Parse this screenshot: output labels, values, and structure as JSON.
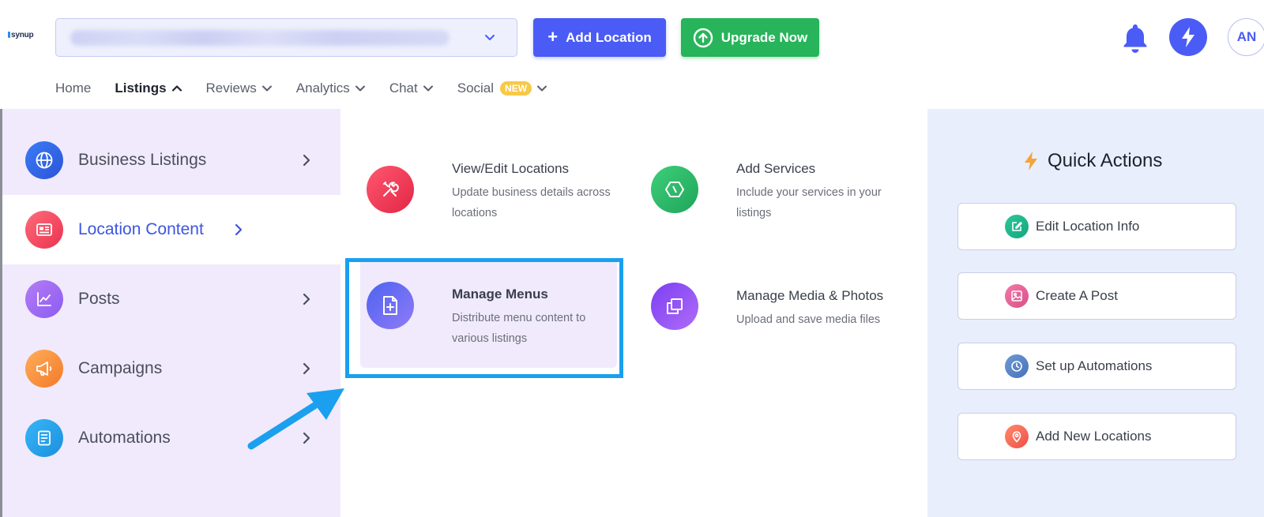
{
  "app": {
    "logo_text": "synup"
  },
  "header": {
    "location_select": {
      "value": ""
    },
    "add_location_label": "Add Location",
    "upgrade_label": "Upgrade Now",
    "avatar_initials": "AN",
    "colors": {
      "primary": "#4a5cf5",
      "success": "#27b45a"
    }
  },
  "nav": {
    "home": "Home",
    "listings": "Listings",
    "reviews": "Reviews",
    "analytics": "Analytics",
    "chat": "Chat",
    "social": "Social",
    "social_badge": "NEW"
  },
  "categories": [
    {
      "label": "Business Listings",
      "icon": "globe-icon"
    },
    {
      "label": "Location Content",
      "icon": "newspaper-icon",
      "active": true
    },
    {
      "label": "Posts",
      "icon": "chart-line-icon"
    },
    {
      "label": "Campaigns",
      "icon": "megaphone-icon"
    },
    {
      "label": "Automations",
      "icon": "document-list-icon"
    }
  ],
  "options": [
    {
      "title": "View/Edit Locations",
      "desc": "Update business details across locations",
      "icon": "tools-icon"
    },
    {
      "title": "Add Services",
      "desc": "Include your services in your listings",
      "icon": "hexagon-icon"
    },
    {
      "title": "Manage Menus",
      "desc": "Distribute menu content to various listings",
      "icon": "file-plus-icon"
    },
    {
      "title": "Manage Media & Photos",
      "desc": "Upload and save media files",
      "icon": "copy-icon"
    }
  ],
  "quick_actions": {
    "title": "Quick Actions",
    "items": [
      {
        "label": "Edit Location Info",
        "icon": "edit-icon"
      },
      {
        "label": "Create A Post",
        "icon": "image-icon"
      },
      {
        "label": "Set up Automations",
        "icon": "clock-icon"
      },
      {
        "label": "Add New Locations",
        "icon": "location-pin-icon"
      }
    ]
  }
}
